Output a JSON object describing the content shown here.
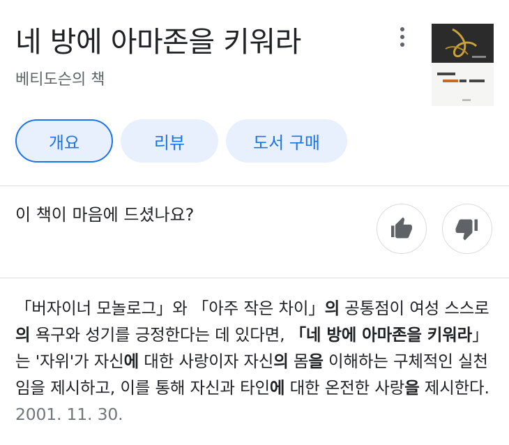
{
  "book": {
    "title": "네 방에 아마존을 키워라",
    "subtitle": "베티도슨의 책"
  },
  "menu": {
    "icon": "more-vert-icon"
  },
  "tabs": [
    {
      "label": "개요",
      "selected": true
    },
    {
      "label": "리뷰",
      "selected": false
    },
    {
      "label": "도서 구매",
      "selected": false
    }
  ],
  "feedback": {
    "question": "이 책이 마음에 드셨나요?",
    "like_icon": "thumb-up-icon",
    "dislike_icon": "thumb-down-icon"
  },
  "description": {
    "segments": [
      {
        "text": "「버자이너 모놀로그」와 「아주 작은 차이」",
        "bold": false
      },
      {
        "text": "의",
        "bold": true
      },
      {
        "text": " 공통점이 여성 스스로",
        "bold": false
      },
      {
        "text": "의",
        "bold": true
      },
      {
        "text": " 욕구와 성기를 긍정한다는 데 있다면, ",
        "bold": false
      },
      {
        "text": "「네 방에 아마존을 키워라",
        "bold": true
      },
      {
        "text": "」는 '자위'가 자신",
        "bold": false
      },
      {
        "text": "에",
        "bold": true
      },
      {
        "text": " 대한 사랑이자 자신",
        "bold": false
      },
      {
        "text": "의",
        "bold": true
      },
      {
        "text": " 몸",
        "bold": false
      },
      {
        "text": "을",
        "bold": true
      },
      {
        "text": " 이해하는 구체적인 실천임을 제시하고, 이를 통해 자신과 타인",
        "bold": false
      },
      {
        "text": "에",
        "bold": true
      },
      {
        "text": " 대한 온전한 사랑",
        "bold": false
      },
      {
        "text": "을",
        "bold": true
      },
      {
        "text": " 제시한다.",
        "bold": false
      }
    ],
    "date": "2001. 11. 30."
  },
  "colors": {
    "accent": "#1a73e8",
    "chip_bg": "#e8f0fe",
    "divider": "#dadce0",
    "secondary_text": "#5f6368"
  }
}
